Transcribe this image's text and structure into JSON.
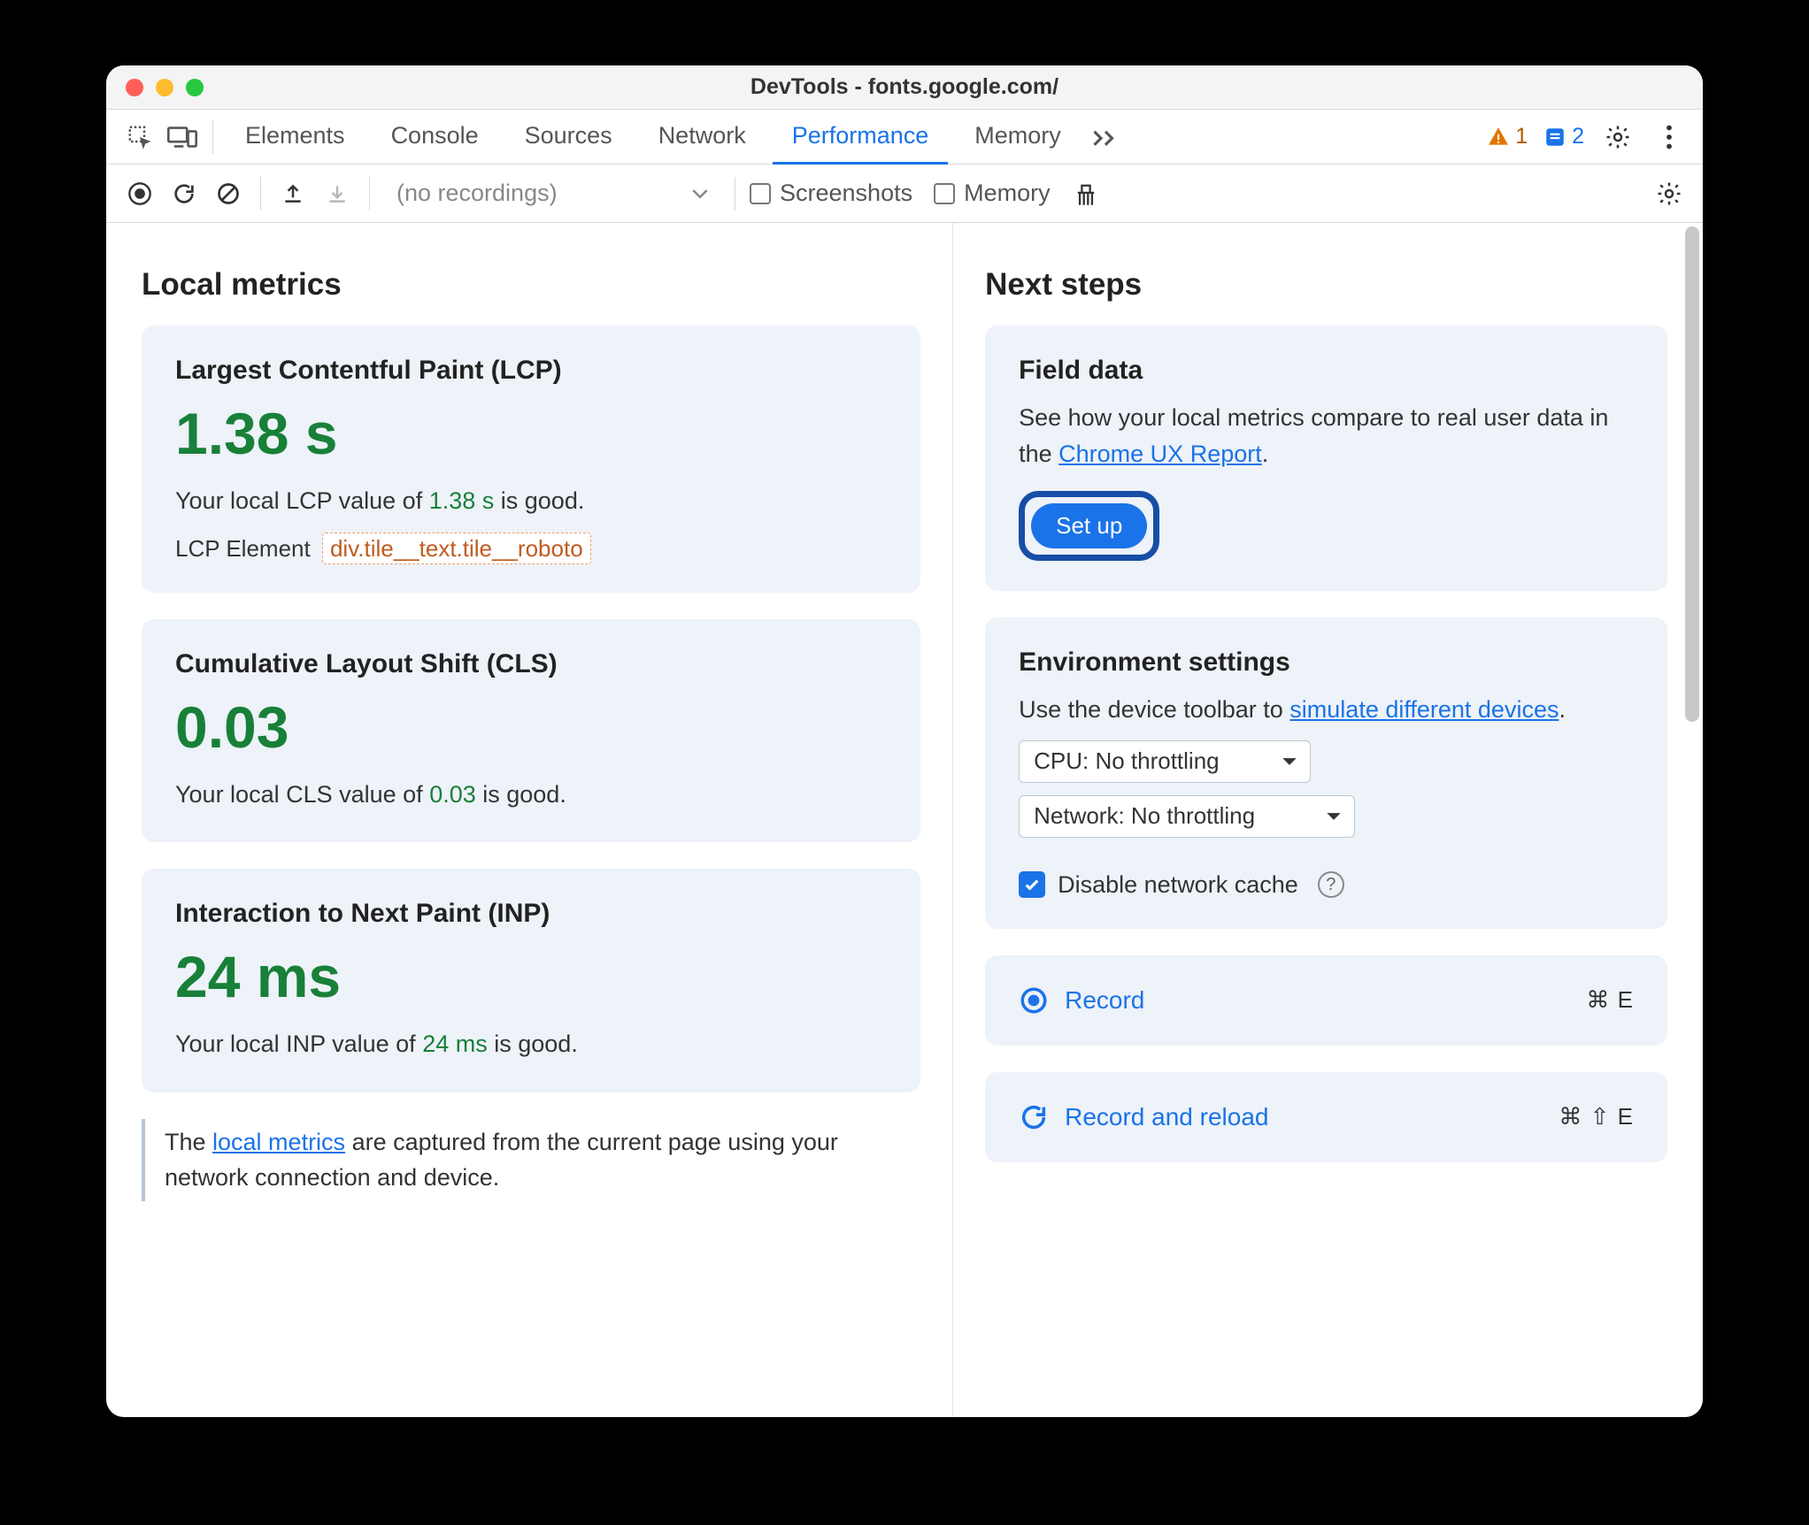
{
  "window": {
    "title": "DevTools - fonts.google.com/"
  },
  "tabs": {
    "elements": "Elements",
    "console": "Console",
    "sources": "Sources",
    "network": "Network",
    "performance": "Performance",
    "memory": "Memory"
  },
  "badges": {
    "warnings": "1",
    "issues": "2"
  },
  "toolbar": {
    "recordings_placeholder": "(no recordings)",
    "screenshots": "Screenshots",
    "memory": "Memory"
  },
  "left": {
    "heading": "Local metrics",
    "lcp": {
      "title": "Largest Contentful Paint (LCP)",
      "value": "1.38 s",
      "desc_prefix": "Your local LCP value of ",
      "desc_value": "1.38 s",
      "desc_suffix": " is good.",
      "element_label": "LCP Element",
      "element_selector": "div.tile__text.tile__roboto"
    },
    "cls": {
      "title": "Cumulative Layout Shift (CLS)",
      "value": "0.03",
      "desc_prefix": "Your local CLS value of ",
      "desc_value": "0.03",
      "desc_suffix": " is good."
    },
    "inp": {
      "title": "Interaction to Next Paint (INP)",
      "value": "24 ms",
      "desc_prefix": "Your local INP value of ",
      "desc_value": "24 ms",
      "desc_suffix": " is good."
    },
    "info_prefix": "The ",
    "info_link": "local metrics",
    "info_suffix": " are captured from the current page using your network connection and device."
  },
  "right": {
    "heading": "Next steps",
    "field": {
      "title": "Field data",
      "desc_prefix": "See how your local metrics compare to real user data in the ",
      "desc_link": "Chrome UX Report",
      "desc_suffix": ".",
      "setup": "Set up"
    },
    "env": {
      "title": "Environment settings",
      "desc_prefix": "Use the device toolbar to ",
      "desc_link": "simulate different devices",
      "desc_suffix": ".",
      "cpu": "CPU: No throttling",
      "net": "Network: No throttling",
      "disable_cache": "Disable network cache"
    },
    "record": {
      "label": "Record",
      "shortcut": "⌘ E"
    },
    "reload": {
      "label": "Record and reload",
      "shortcut": "⌘ ⇧ E"
    }
  }
}
